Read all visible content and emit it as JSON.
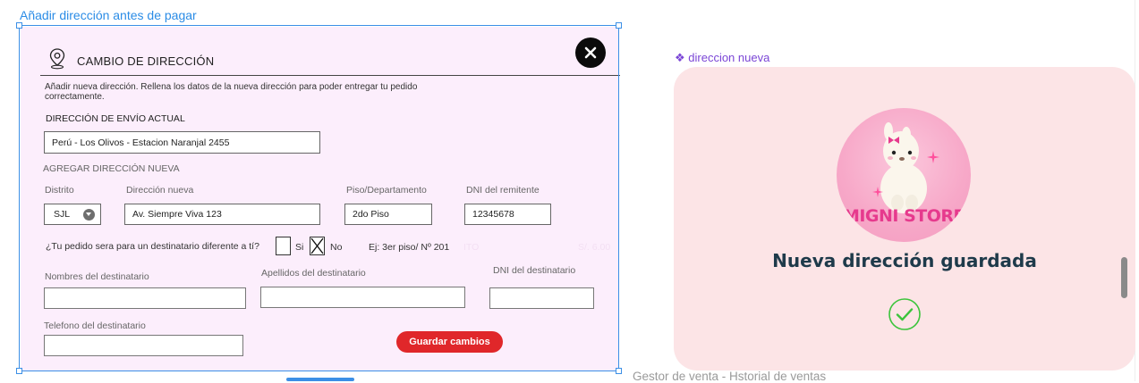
{
  "frame": {
    "label": "Añadir dirección antes de pagar"
  },
  "modal": {
    "title": "CAMBIO DE DIRECCIÓN",
    "description": "Añadir nueva dirección. Rellena los datos de la nueva dirección para poder entregar tu pedido correctamente.",
    "current_address": {
      "label": "DIRECCIÓN DE ENVÍO ACTUAL",
      "value": "Perú - Los Olivos - Estacion Naranjal 2455"
    },
    "new_address": {
      "section_label": "AGREGAR DIRECCIÓN NUEVA",
      "district_label": "Distrito",
      "district_value": "SJL",
      "address_label": "Dirección nueva",
      "address_value": "Av. Siempre Viva 123",
      "floor_label": "Piso/Departamento",
      "floor_value": "2do Piso",
      "dni_label": "DNI del remitente",
      "dni_value": "12345678"
    },
    "recipient": {
      "question": "¿Tu pedido sera para un destinatario diferente a tí?",
      "yes_label": "Si",
      "no_label": "No",
      "example": "Ej: 3er piso/ Nº 201",
      "names_label": "Nombres  del destinatario",
      "surnames_label": "Apellidos  del destinatario",
      "dni_label": "DNI del destinatario",
      "phone_label": "Telefono del destinatario",
      "names_value": "",
      "surnames_value": "",
      "dni_value": "",
      "phone_value": ""
    },
    "save_button": "Guardar cambios",
    "ghost_texts": [
      "ITO",
      "S/. 6.00"
    ]
  },
  "confirmation": {
    "component_label": "❖ direccion nueva",
    "brand": "MIGNI STORF",
    "message": "Nueva dirección guardada"
  },
  "bottom": {
    "label": "Gestor de venta - Hstorial de ventas"
  },
  "colors": {
    "selection": "#3c8fe6",
    "modal_bg": "#fceefc",
    "save_button": "#e0272a",
    "confirm_bg": "#fce4e6",
    "brand_pink": "#e63a8d",
    "check_green": "#3cc43c",
    "component_purple": "#7a45d6"
  },
  "icons": [
    "location-pin-icon",
    "close-icon",
    "chevron-down-icon",
    "x-mark-icon",
    "checkmark-circle-icon",
    "sparkle-icon"
  ]
}
